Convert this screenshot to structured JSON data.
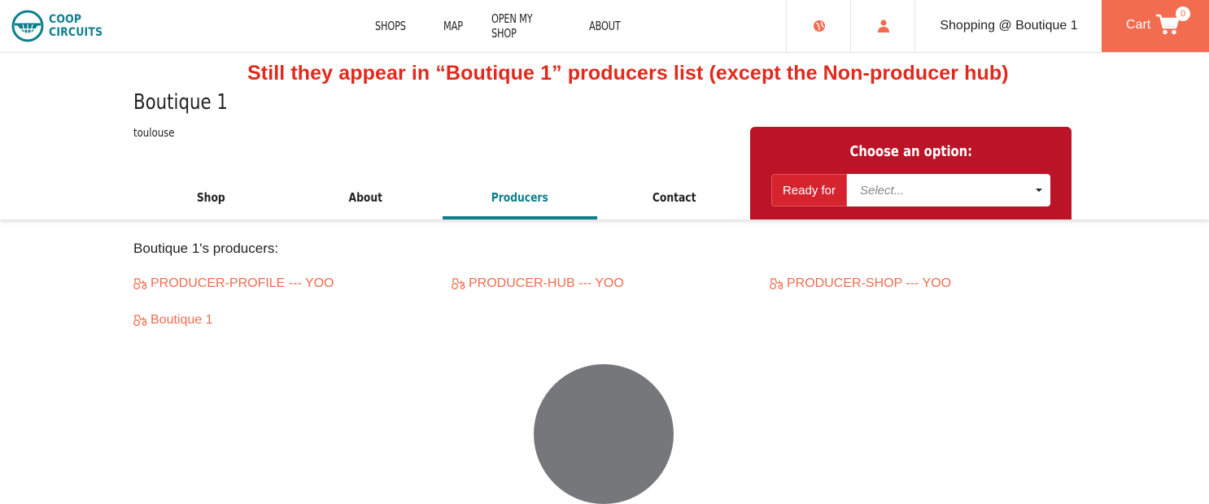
{
  "brand": {
    "line1": "COOP",
    "line2": "CIRCUITS"
  },
  "nav": {
    "items": [
      "SHOPS",
      "MAP",
      "OPEN MY SHOP",
      "ABOUT"
    ],
    "shopping_label": "Shopping @ Boutique 1",
    "cart_label": "Cart",
    "cart_count": "0"
  },
  "annotation": "Still they appear in “Boutique 1” producers list (except the Non-producer hub)",
  "shop": {
    "name": "Boutique 1",
    "city": "toulouse"
  },
  "tabs": [
    {
      "label": "Shop"
    },
    {
      "label": "About"
    },
    {
      "label": "Producers"
    },
    {
      "label": "Contact"
    }
  ],
  "order_cycle": {
    "title": "Choose an option:",
    "ready_for_label": "Ready for",
    "select_placeholder": "Select..."
  },
  "producers": {
    "heading": "Boutique 1's producers:",
    "items": [
      {
        "name": "PRODUCER-PROFILE --- YOO"
      },
      {
        "name": "PRODUCER-HUB --- YOO"
      },
      {
        "name": "PRODUCER-SHOP --- YOO"
      },
      {
        "name": "Boutique 1"
      }
    ]
  },
  "colors": {
    "brand_teal": "#0d7f8c",
    "accent_orange": "#f26c4f",
    "option_red": "#bb1327",
    "annotation_red": "#e2291c"
  },
  "icons": [
    "globe-icon",
    "user-icon",
    "cart-icon",
    "tractor-icon"
  ]
}
